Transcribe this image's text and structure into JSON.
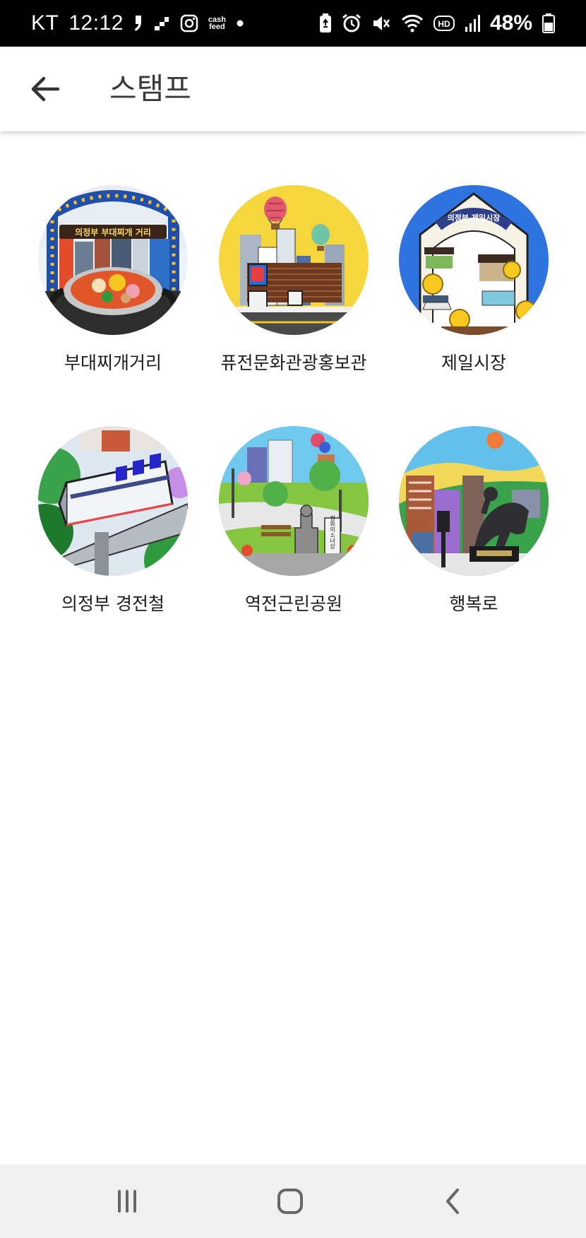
{
  "status_bar": {
    "carrier": "KT",
    "time": "12:12",
    "cash_feed_line1": "cash",
    "cash_feed_line2": "feed",
    "hd_badge": "HD",
    "battery_percent": "48%",
    "icons_left": [
      "notification-icon",
      "stairs-app-icon",
      "instagram-icon",
      "cash-feed-icon",
      "dot-icon"
    ],
    "icons_right": [
      "battery-saver-icon",
      "alarm-icon",
      "mute-icon",
      "wifi-icon",
      "hd-icon",
      "signal-icon",
      "battery-icon"
    ]
  },
  "app_bar": {
    "back_icon": "arrow-left-icon",
    "title": "스탬프"
  },
  "stamps": [
    {
      "label": "부대찌개거리",
      "banner": "의정부 부대찌개 거리"
    },
    {
      "label": "퓨전문화관광홍보관"
    },
    {
      "label": "제일시장",
      "banner": "의정부 제일시장"
    },
    {
      "label": "의정부 경전철"
    },
    {
      "label": "역전근린공원",
      "plaque": "평화의소녀상"
    },
    {
      "label": "행복로"
    }
  ],
  "nav_bar": {
    "buttons": [
      "recents-icon",
      "home-icon",
      "back-icon"
    ]
  }
}
